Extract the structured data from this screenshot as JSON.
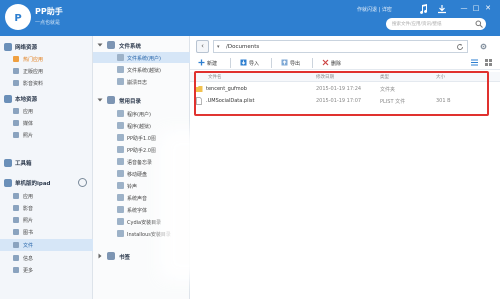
{
  "app": {
    "title": "PP助手",
    "subtitle": "一点也就是",
    "top_links": "作就闪退 | 详密",
    "search_placeholder": "搜索文件/应用/资讯/壁纸"
  },
  "window_buttons": [
    "—",
    "□",
    "✕"
  ],
  "left_nav": {
    "sections": [
      {
        "label": "网络资源",
        "items": [
          {
            "label": "热门应用",
            "style": "orange"
          },
          {
            "label": "正版应用",
            "style": "normal"
          },
          {
            "label": "影音资料",
            "style": "normal"
          }
        ]
      },
      {
        "label": "本地资源",
        "items": [
          {
            "label": "应用",
            "style": "normal"
          },
          {
            "label": "媒体",
            "style": "normal"
          },
          {
            "label": "照片",
            "style": "normal"
          }
        ]
      },
      {
        "label": "工具箱",
        "items": []
      },
      {
        "label": "单机版的ipad",
        "items": [
          {
            "label": "应用",
            "style": "normal"
          },
          {
            "label": "影音",
            "style": "normal"
          },
          {
            "label": "照片",
            "style": "normal"
          },
          {
            "label": "图书",
            "style": "normal"
          },
          {
            "label": "文件",
            "style": "active"
          },
          {
            "label": "信息",
            "style": "normal"
          },
          {
            "label": "更多",
            "style": "normal"
          }
        ]
      }
    ]
  },
  "mid_panel": {
    "file_system_header": "文件系统",
    "file_system_items": [
      "文件系统(用户)",
      "文件系统(越狱)",
      "崩溃日志"
    ],
    "common_dirs_header": "常用目录",
    "common_dirs": [
      "程序(用户)",
      "程序(越狱)",
      "PP助手1.0图",
      "PP助手2.0图",
      "语音备忘录",
      "移动硬盘",
      "铃声",
      "系统声音",
      "系统字体",
      "Cydia安装目录",
      "Installous安装目录"
    ],
    "bookmarks_header": "书签"
  },
  "content": {
    "path": "/Documents",
    "toolbar": {
      "new": "新建",
      "import": "导入",
      "export": "导出",
      "delete": "删除"
    },
    "columns": [
      "文件名",
      "修改日期",
      "类型",
      "大小"
    ],
    "files": [
      {
        "name": "tencent_gufmob",
        "modified": "2015-01-19 17:24",
        "type": "文件夹",
        "size": "",
        "icon": "folder-icon"
      },
      {
        "name": ".UMSocialData.plist",
        "modified": "2015-01-19 17:07",
        "type": "PLIST 文件",
        "size": "301 B",
        "icon": "file-icon"
      }
    ]
  },
  "colors": {
    "titlebar": "#2e7fd0",
    "highlight": "#e0312e",
    "active_bg": "#d6e6f7"
  }
}
